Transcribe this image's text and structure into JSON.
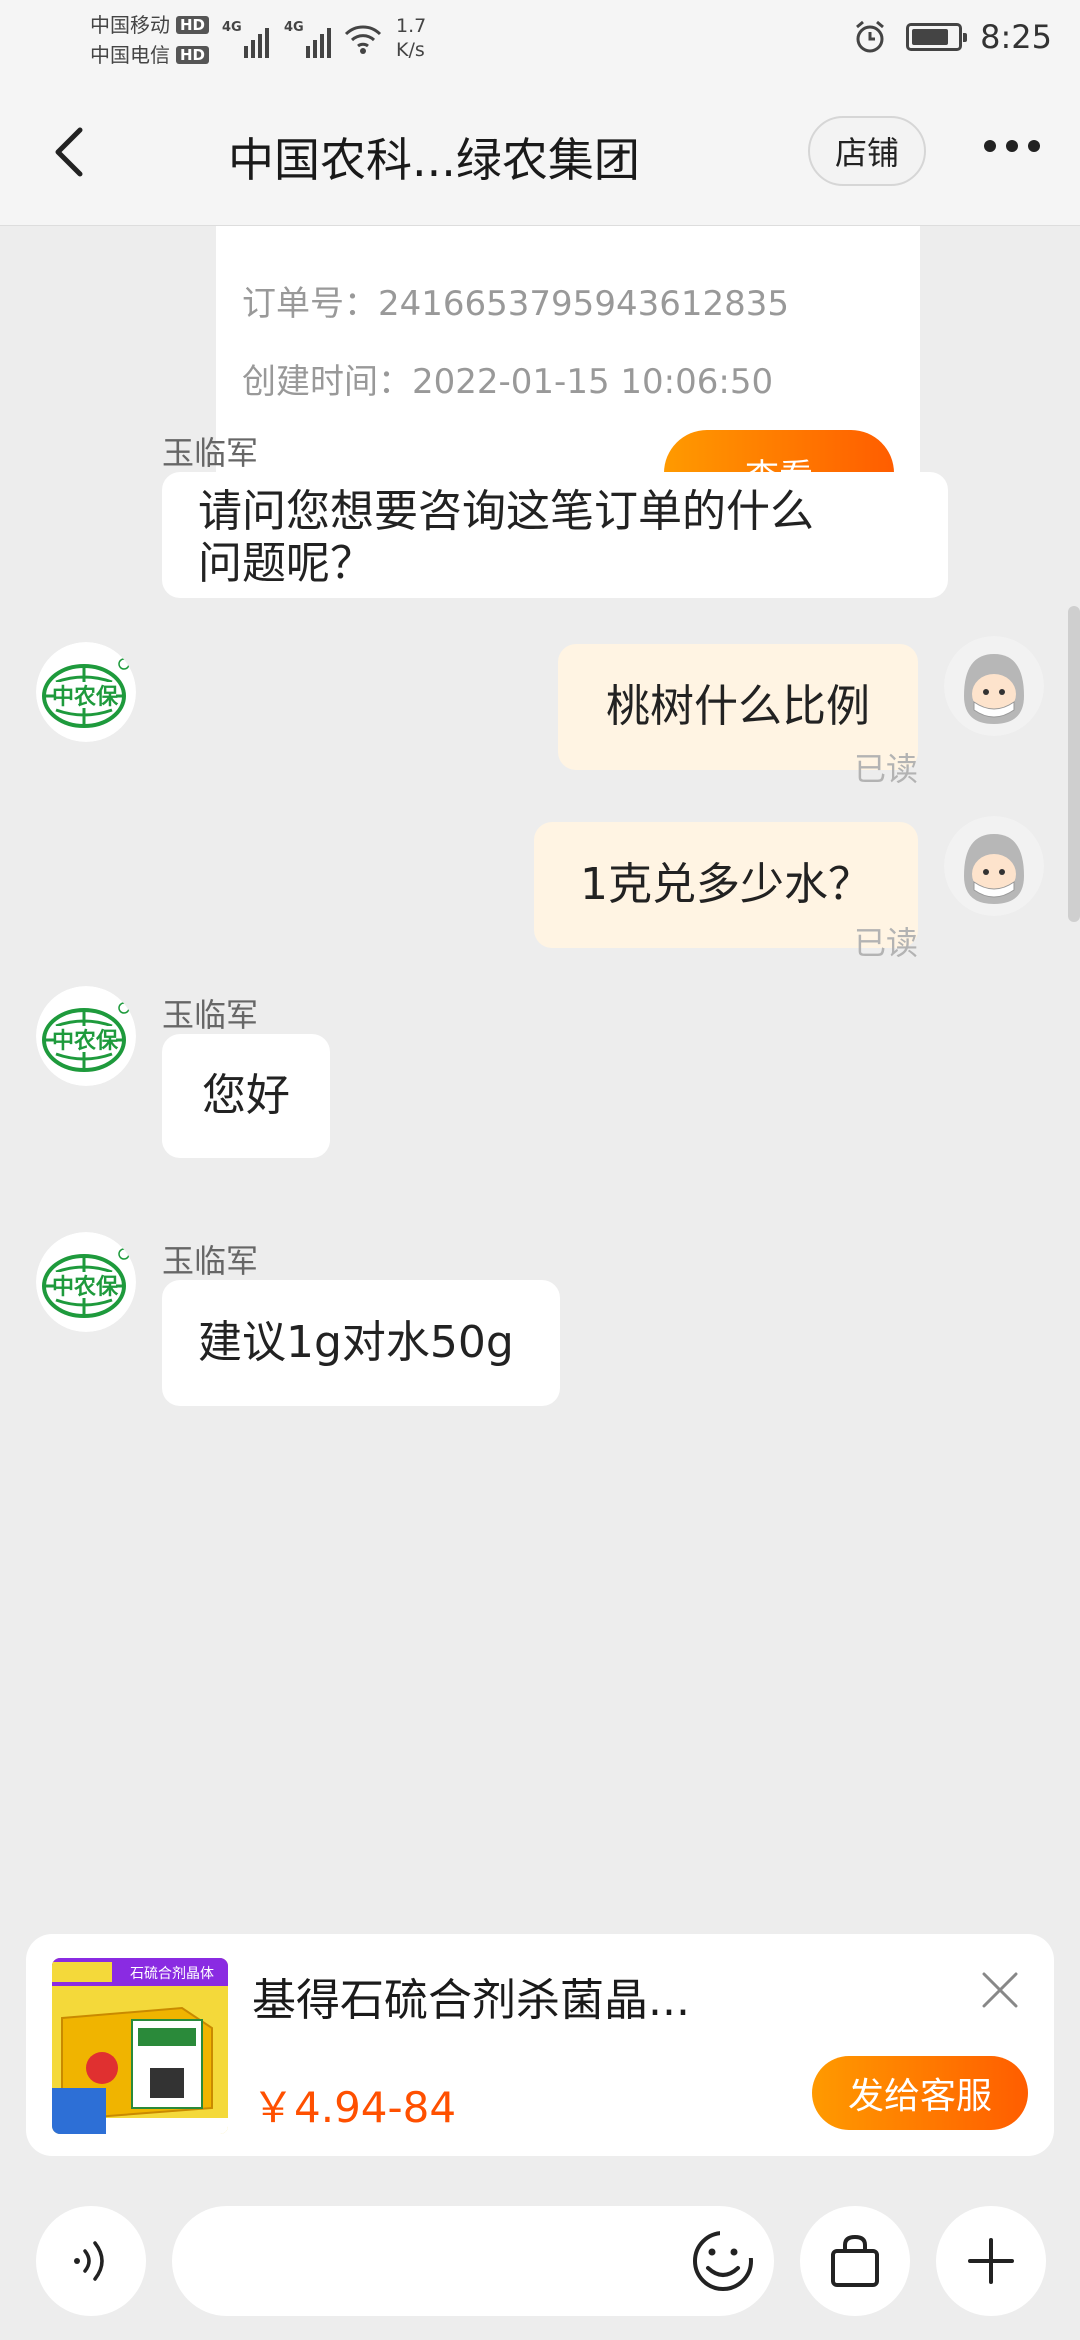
{
  "status_bar": {
    "carrier1": "中国移动",
    "carrier2": "中国电信",
    "hd": "HD",
    "net": "4G",
    "speed_value": "1.7",
    "speed_unit": "K/s",
    "time": "8:25"
  },
  "nav": {
    "title": "中国农科...绿农集团",
    "shop_label": "店铺"
  },
  "order": {
    "order_no_label": "订单号：",
    "order_no": "2416653795943612835",
    "created_label": "创建时间：",
    "created_time": "2022-01-15 10:06:50",
    "view_label": "查看"
  },
  "read_label": "已读",
  "messages": [
    {
      "side": "left",
      "sender": "玉临军",
      "text_line1": "请问您想要咨询这笔订单的什么",
      "text_line2": "问题呢？"
    },
    {
      "side": "right",
      "text": "桃树什么比例"
    },
    {
      "side": "right",
      "text": "1克兑多少水？"
    },
    {
      "side": "left",
      "sender": "玉临军",
      "text": "您好"
    },
    {
      "side": "left",
      "sender": "玉临军",
      "text": "建议1g对水50g"
    }
  ],
  "product": {
    "name": "基得石硫合剂杀菌晶...",
    "price": "￥4.94-84",
    "send_label": "发给客服",
    "img_banner": "石硫合剂晶体"
  },
  "colors": {
    "accent_orange": "#ff6a00",
    "price": "#ff5000",
    "logo_green": "#1e9a3c",
    "bubble_mine": "#fff4e3"
  },
  "icons": [
    "back-icon",
    "more-icon",
    "voice-icon",
    "emoji-icon",
    "bag-icon",
    "plus-icon",
    "close-icon"
  ]
}
